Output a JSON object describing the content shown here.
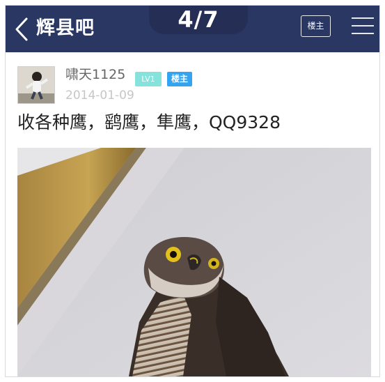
{
  "header": {
    "back_icon": "chevron-left-icon",
    "forum_title": "辉县吧",
    "image_counter": "4/7",
    "owner_only_label": "楼主",
    "menu_icon": "hamburger-menu-icon",
    "background_color": "#2a3763"
  },
  "post": {
    "author": {
      "avatar_icon": "user-avatar",
      "username": "啸天1125",
      "level_badge": "LV1",
      "owner_badge": "楼主",
      "level_badge_color": "#86e3db",
      "owner_badge_color": "#35a4f0"
    },
    "date": "2014-01-09",
    "text": "收各种鹰，鹞鹰，隼鹰，QQ9328",
    "image": {
      "description_icon": "hawk-photo"
    }
  }
}
